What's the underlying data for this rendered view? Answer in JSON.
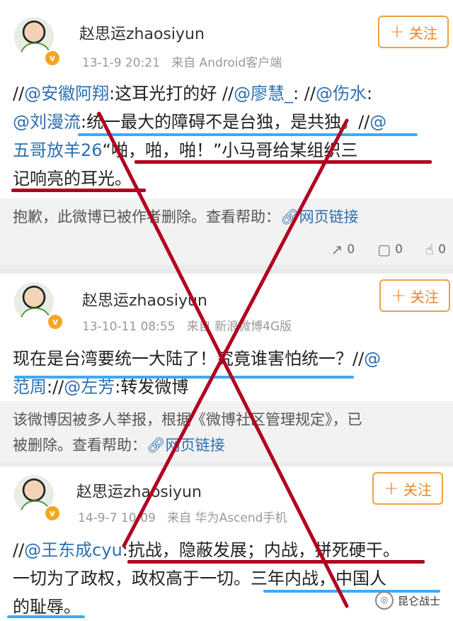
{
  "posts": [
    {
      "username": "赵思运zhaosiyun",
      "timestamp": "13-1-9 20:21",
      "source": "来自 Android客户端",
      "follow_label": "关注",
      "line1": [
        "//",
        "@安徽阿翔",
        ":这耳光打的好 //",
        "@廖慧_",
        ": //",
        "@伤水",
        ":"
      ],
      "line2": [
        "@刘漫流",
        ":统一最大的障碍不是台独，是共独。//",
        "@"
      ],
      "line3": [
        "五哥放羊26",
        "“啪，啪，啪！”小马哥给某组织三"
      ],
      "line4": "记响亮的耳光。",
      "deleted_notice": "抱歉，此微博已被作者删除。查看帮助：",
      "link_label": "网页链接",
      "repost_count": "0",
      "comment_count": "0",
      "like_count": "0"
    },
    {
      "username": "赵思运zhaosiyun",
      "timestamp": "13-10-11 08:55",
      "source": "来自 新浪微博4G版",
      "follow_label": "关注",
      "line1": [
        "现在是台湾要统一大陆了！究竟谁害怕统一？//",
        "@"
      ],
      "line2": [
        "范周",
        "://",
        "@左芳",
        ":转发微博"
      ],
      "deleted_notice_1": "该微博因被多人举报，根据《微博社区管理规定》，已",
      "deleted_notice_2": "被删除。查看帮助：",
      "link_label": "网页链接"
    },
    {
      "username": "赵思运zhaosiyun",
      "timestamp": "14-9-7 10:09",
      "source": "来自 华为Ascend手机",
      "follow_label": "关注",
      "line1": [
        "//",
        "@王东成cyu",
        ":抗战，隐蔽发展；内战，拼死硬干。"
      ],
      "line2": "一切为了政权，政权高于一切。三年内战，中国人",
      "line3": "的耻辱。"
    }
  ],
  "watermark": "昆仑战士",
  "colors": {
    "mention": "#2d6fb0",
    "follow": "#e8872a",
    "cross": "#b00020",
    "underline_blue": "#3fa9f5",
    "underline_red": "#b00020"
  },
  "icons": {
    "repost": "repost-icon",
    "comment": "comment-icon",
    "like": "like-icon",
    "link": "link-icon",
    "verified": "verified-badge-icon"
  }
}
